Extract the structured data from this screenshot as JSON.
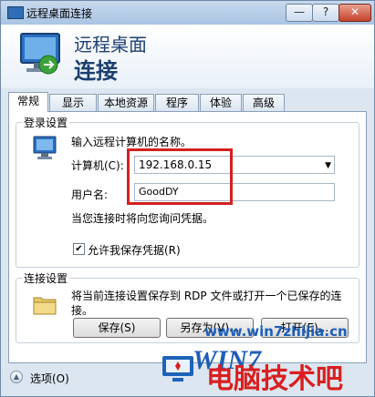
{
  "window": {
    "title": "远程桌面连接",
    "minimize_glyph": "—",
    "help_glyph": "?",
    "close_glyph": "✕"
  },
  "header": {
    "line1": "远程桌面",
    "line2": "连接"
  },
  "tabs": [
    {
      "label": "常规",
      "active": true
    },
    {
      "label": "显示",
      "active": false
    },
    {
      "label": "本地资源",
      "active": false
    },
    {
      "label": "程序",
      "active": false
    },
    {
      "label": "体验",
      "active": false
    },
    {
      "label": "高级",
      "active": false
    }
  ],
  "login_settings": {
    "legend": "登录设置",
    "prompt": "输入远程计算机的名称。",
    "computer_label": "计算机(C):",
    "computer_value": "192.168.0.15",
    "username_label": "用户名:",
    "username_value": "GoodDY",
    "credential_note": "当您连接时将向您询问凭据。",
    "allow_save_label": "允许我保存凭据(R)",
    "allow_save_checked": true
  },
  "connection_settings": {
    "legend": "连接设置",
    "description": "将当前连接设置保存到 RDP 文件或打开一个已保存的连接。",
    "save_button": "保存(S)",
    "save_as_button": "另存为(V)...",
    "open_button": "打开(E)..."
  },
  "footer": {
    "options_label": "选项(O)"
  },
  "watermark": {
    "logo": "WIN7",
    "url": "www.win7zhijia.cn",
    "big_text": "电脑技术吧"
  },
  "colors": {
    "highlight_box": "#d42020",
    "title_bar": "#a9c4e4"
  },
  "icons": [
    "rdp-monitor-icon",
    "computer-icon",
    "folder-icon",
    "options-expand-icon",
    "checkbox-check-icon"
  ]
}
